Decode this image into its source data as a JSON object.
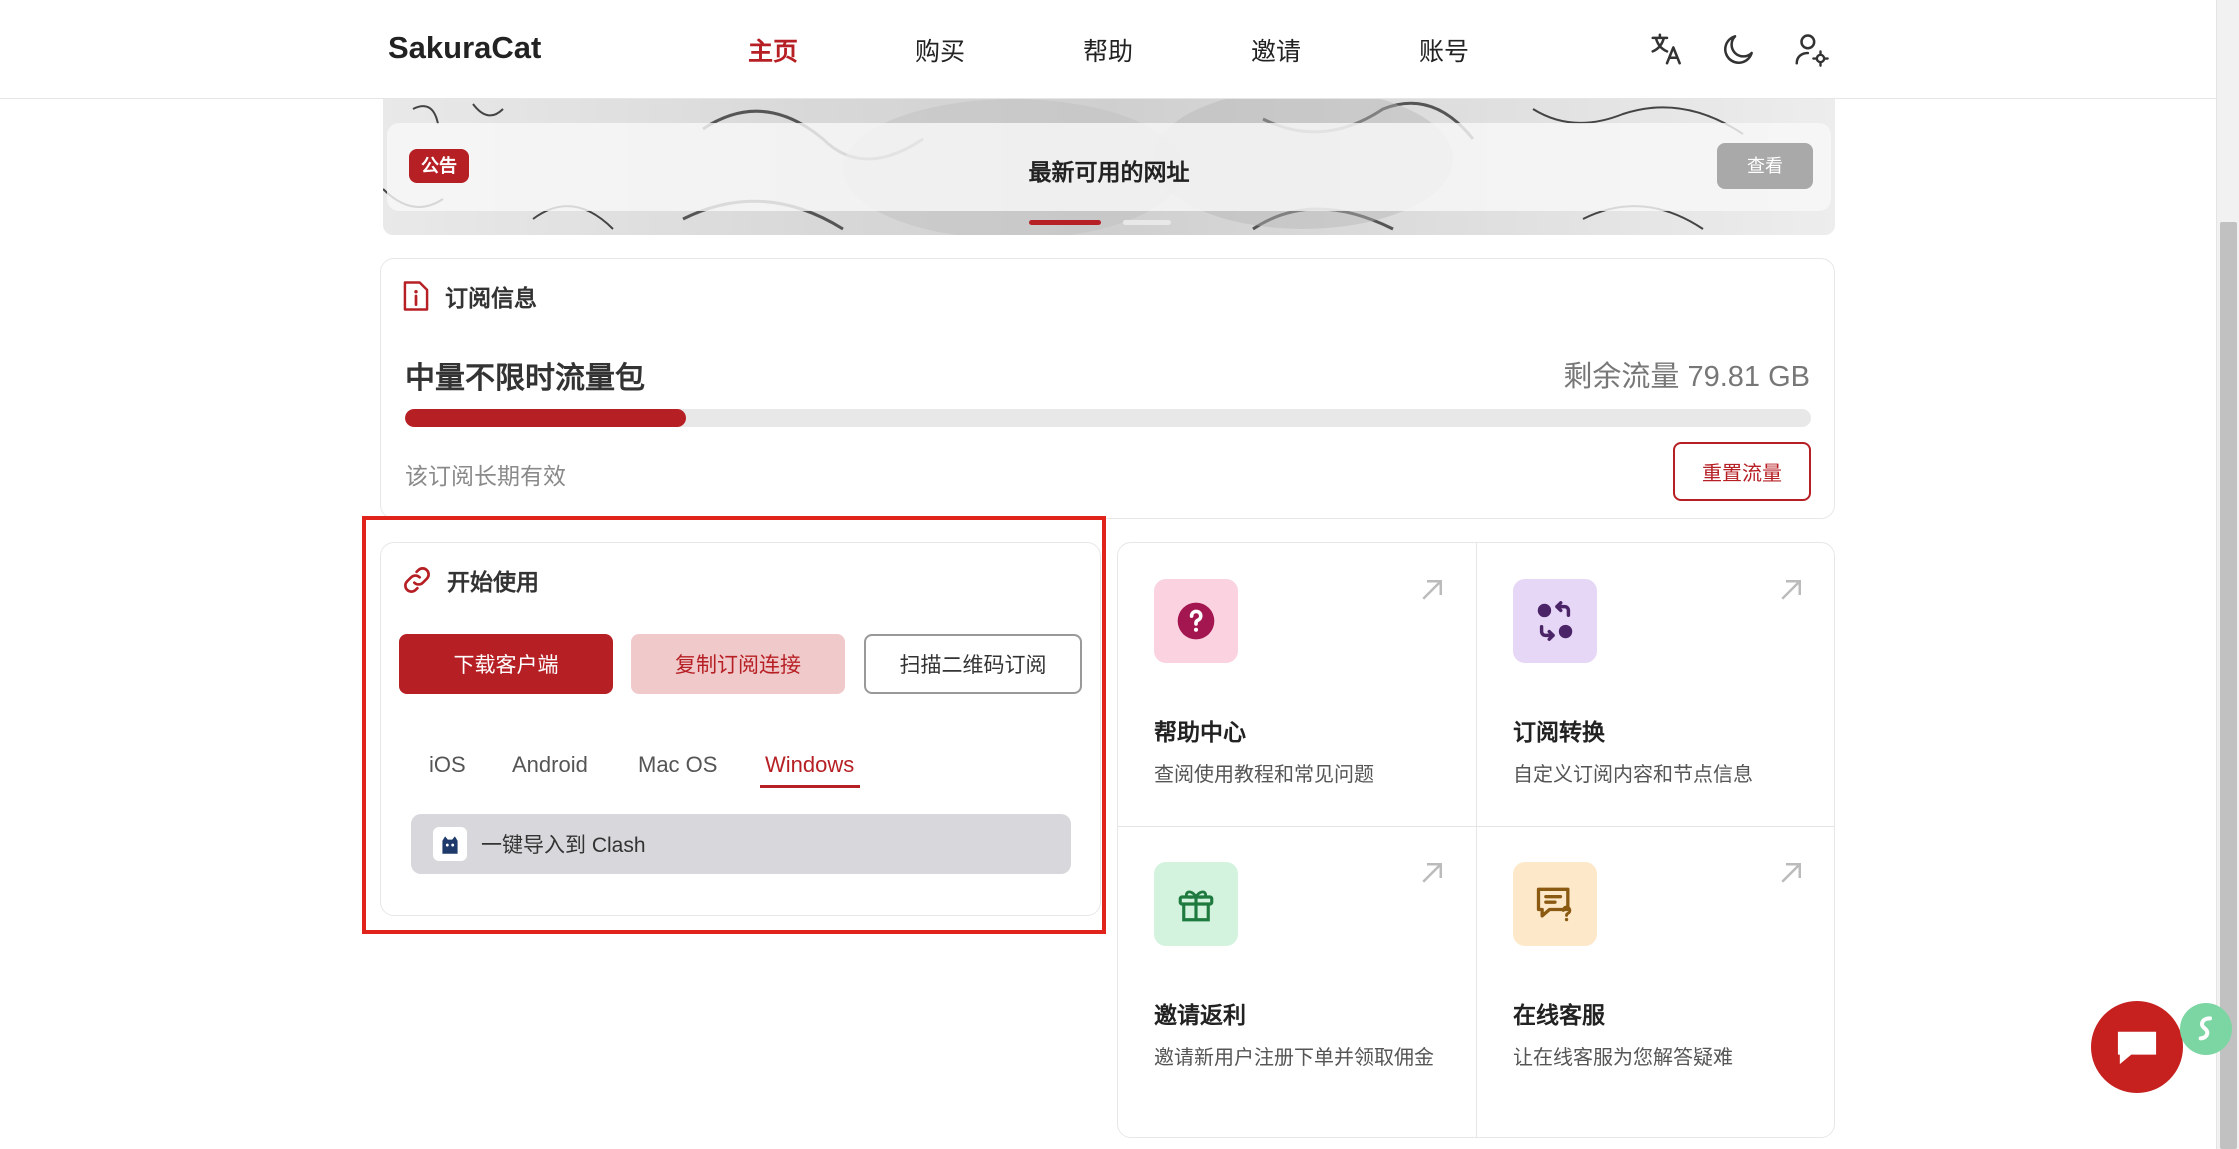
{
  "header": {
    "brand": "SakuraCat",
    "nav": [
      {
        "label": "主页",
        "active": true
      },
      {
        "label": "购买",
        "active": false
      },
      {
        "label": "帮助",
        "active": false
      },
      {
        "label": "邀请",
        "active": false
      },
      {
        "label": "账号",
        "active": false
      }
    ],
    "icons": [
      "translate-icon",
      "dark-mode-icon",
      "user-settings-icon"
    ]
  },
  "banner": {
    "badge": "公告",
    "title": "最新可用的网址",
    "view_label": "查看",
    "slides": 2,
    "active_slide": 1
  },
  "subscription": {
    "section_title": "订阅信息",
    "plan_name": "中量不限时流量包",
    "remaining": "剩余流量 79.81 GB",
    "usage_fraction": 0.2,
    "validity": "该订阅长期有效",
    "reset_label": "重置流量"
  },
  "start": {
    "section_title": "开始使用",
    "buttons": {
      "download": "下载客户端",
      "copy": "复制订阅连接",
      "scan": "扫描二维码订阅"
    },
    "tabs": [
      "iOS",
      "Android",
      "Mac OS",
      "Windows"
    ],
    "active_tab": "Windows",
    "import_label": "一键导入到 Clash"
  },
  "quick_links": [
    {
      "title": "帮助中心",
      "desc": "查阅使用教程和常见问题",
      "icon": "help-icon",
      "color": "#fbd3e0"
    },
    {
      "title": "订阅转换",
      "desc": "自定义订阅内容和节点信息",
      "icon": "convert-icon",
      "color": "#e6d7f7"
    },
    {
      "title": "邀请返利",
      "desc": "邀请新用户注册下单并领取佣金",
      "icon": "gift-icon",
      "color": "#d3f3df"
    },
    {
      "title": "在线客服",
      "desc": "让在线客服为您解答疑难",
      "icon": "support-icon",
      "color": "#fde9c9"
    }
  ],
  "colors": {
    "brand": "#b61f24",
    "highlight": "#e0231b"
  }
}
